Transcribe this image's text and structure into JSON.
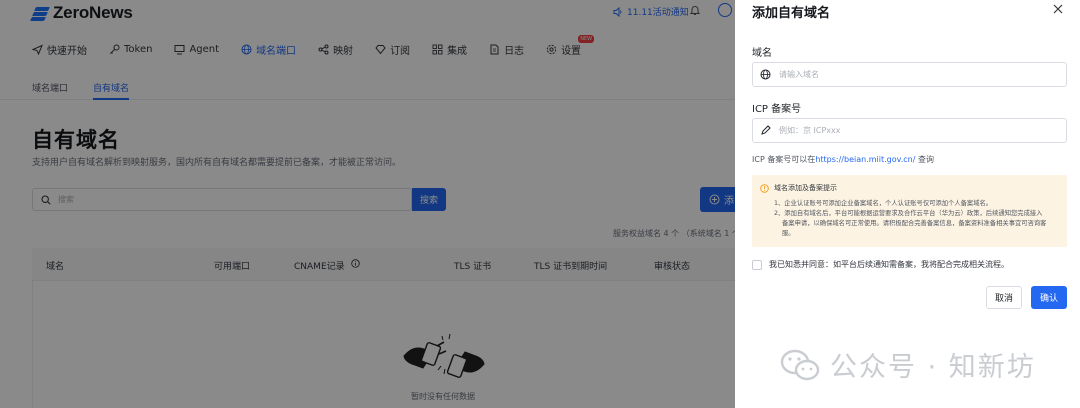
{
  "app": {
    "logo_text": "ZeroNews"
  },
  "topbar": {
    "notice": "11.11活动通知"
  },
  "nav": {
    "items": [
      {
        "label": "快速开始",
        "icon": "send-icon"
      },
      {
        "label": "Token",
        "icon": "key-icon"
      },
      {
        "label": "Agent",
        "icon": "monitor-icon"
      },
      {
        "label": "域名端口",
        "icon": "globe-icon",
        "active": true
      },
      {
        "label": "映射",
        "icon": "share-icon"
      },
      {
        "label": "订阅",
        "icon": "diamond-icon"
      },
      {
        "label": "集成",
        "icon": "grid-icon"
      },
      {
        "label": "日志",
        "icon": "document-icon"
      },
      {
        "label": "设置",
        "icon": "gear-icon",
        "badge": "NEW"
      }
    ]
  },
  "subnav": {
    "tabs": [
      "域名端口",
      "自有域名"
    ],
    "active": "自有域名"
  },
  "main": {
    "title": "自有域名",
    "description": "支持用户自有域名解析到映射服务，国内所有自有域名都需要提前已备案，才能被正常访问。",
    "search_placeholder": "搜索",
    "search_button": "搜索",
    "add_button": "添",
    "quota_text": "服务权益域名 4 个 （系统域名 1 个",
    "columns": [
      "域名",
      "可用端口",
      "CNAME记录",
      "TLS 证书",
      "TLS 证书到期时间",
      "审核状态"
    ],
    "empty_text": "暂时没有任何数据"
  },
  "drawer": {
    "title": "添加自有域名",
    "domain_label": "域名",
    "domain_placeholder": "请输入域名",
    "icp_label": "ICP 备案号",
    "icp_placeholder": "例如：京 ICPxxx",
    "icp_hint_prefix": "ICP 备案号可以在",
    "icp_hint_link": "https://beian.miit.gov.cn/",
    "icp_hint_suffix": " 查询",
    "warning": {
      "title": "域名添加及备案提示",
      "line1": "1、企业认证账号可添加企业备案域名，个人认证账号仅可添加个人备案域名。",
      "line2": "2、添加自有域名后，平台可能根据运营要求及合作云平台（华为云）政策，后续通知您完成接入",
      "line3": "备案申请，以确保域名可正常使用。请积极配合完善备案信息，备案资料准备相关事宜可咨询客",
      "line4": "服。"
    },
    "agree_text": "我已知悉并同意：如平台后续通知需备案，我将配合完成相关流程。",
    "cancel": "取消",
    "confirm": "确认"
  },
  "watermark": {
    "text": "公众号 · 知新坊"
  },
  "colors": {
    "accent": "#2468f2",
    "warning_bg": "#fdf3e3",
    "warning_icon": "#f0a020"
  }
}
